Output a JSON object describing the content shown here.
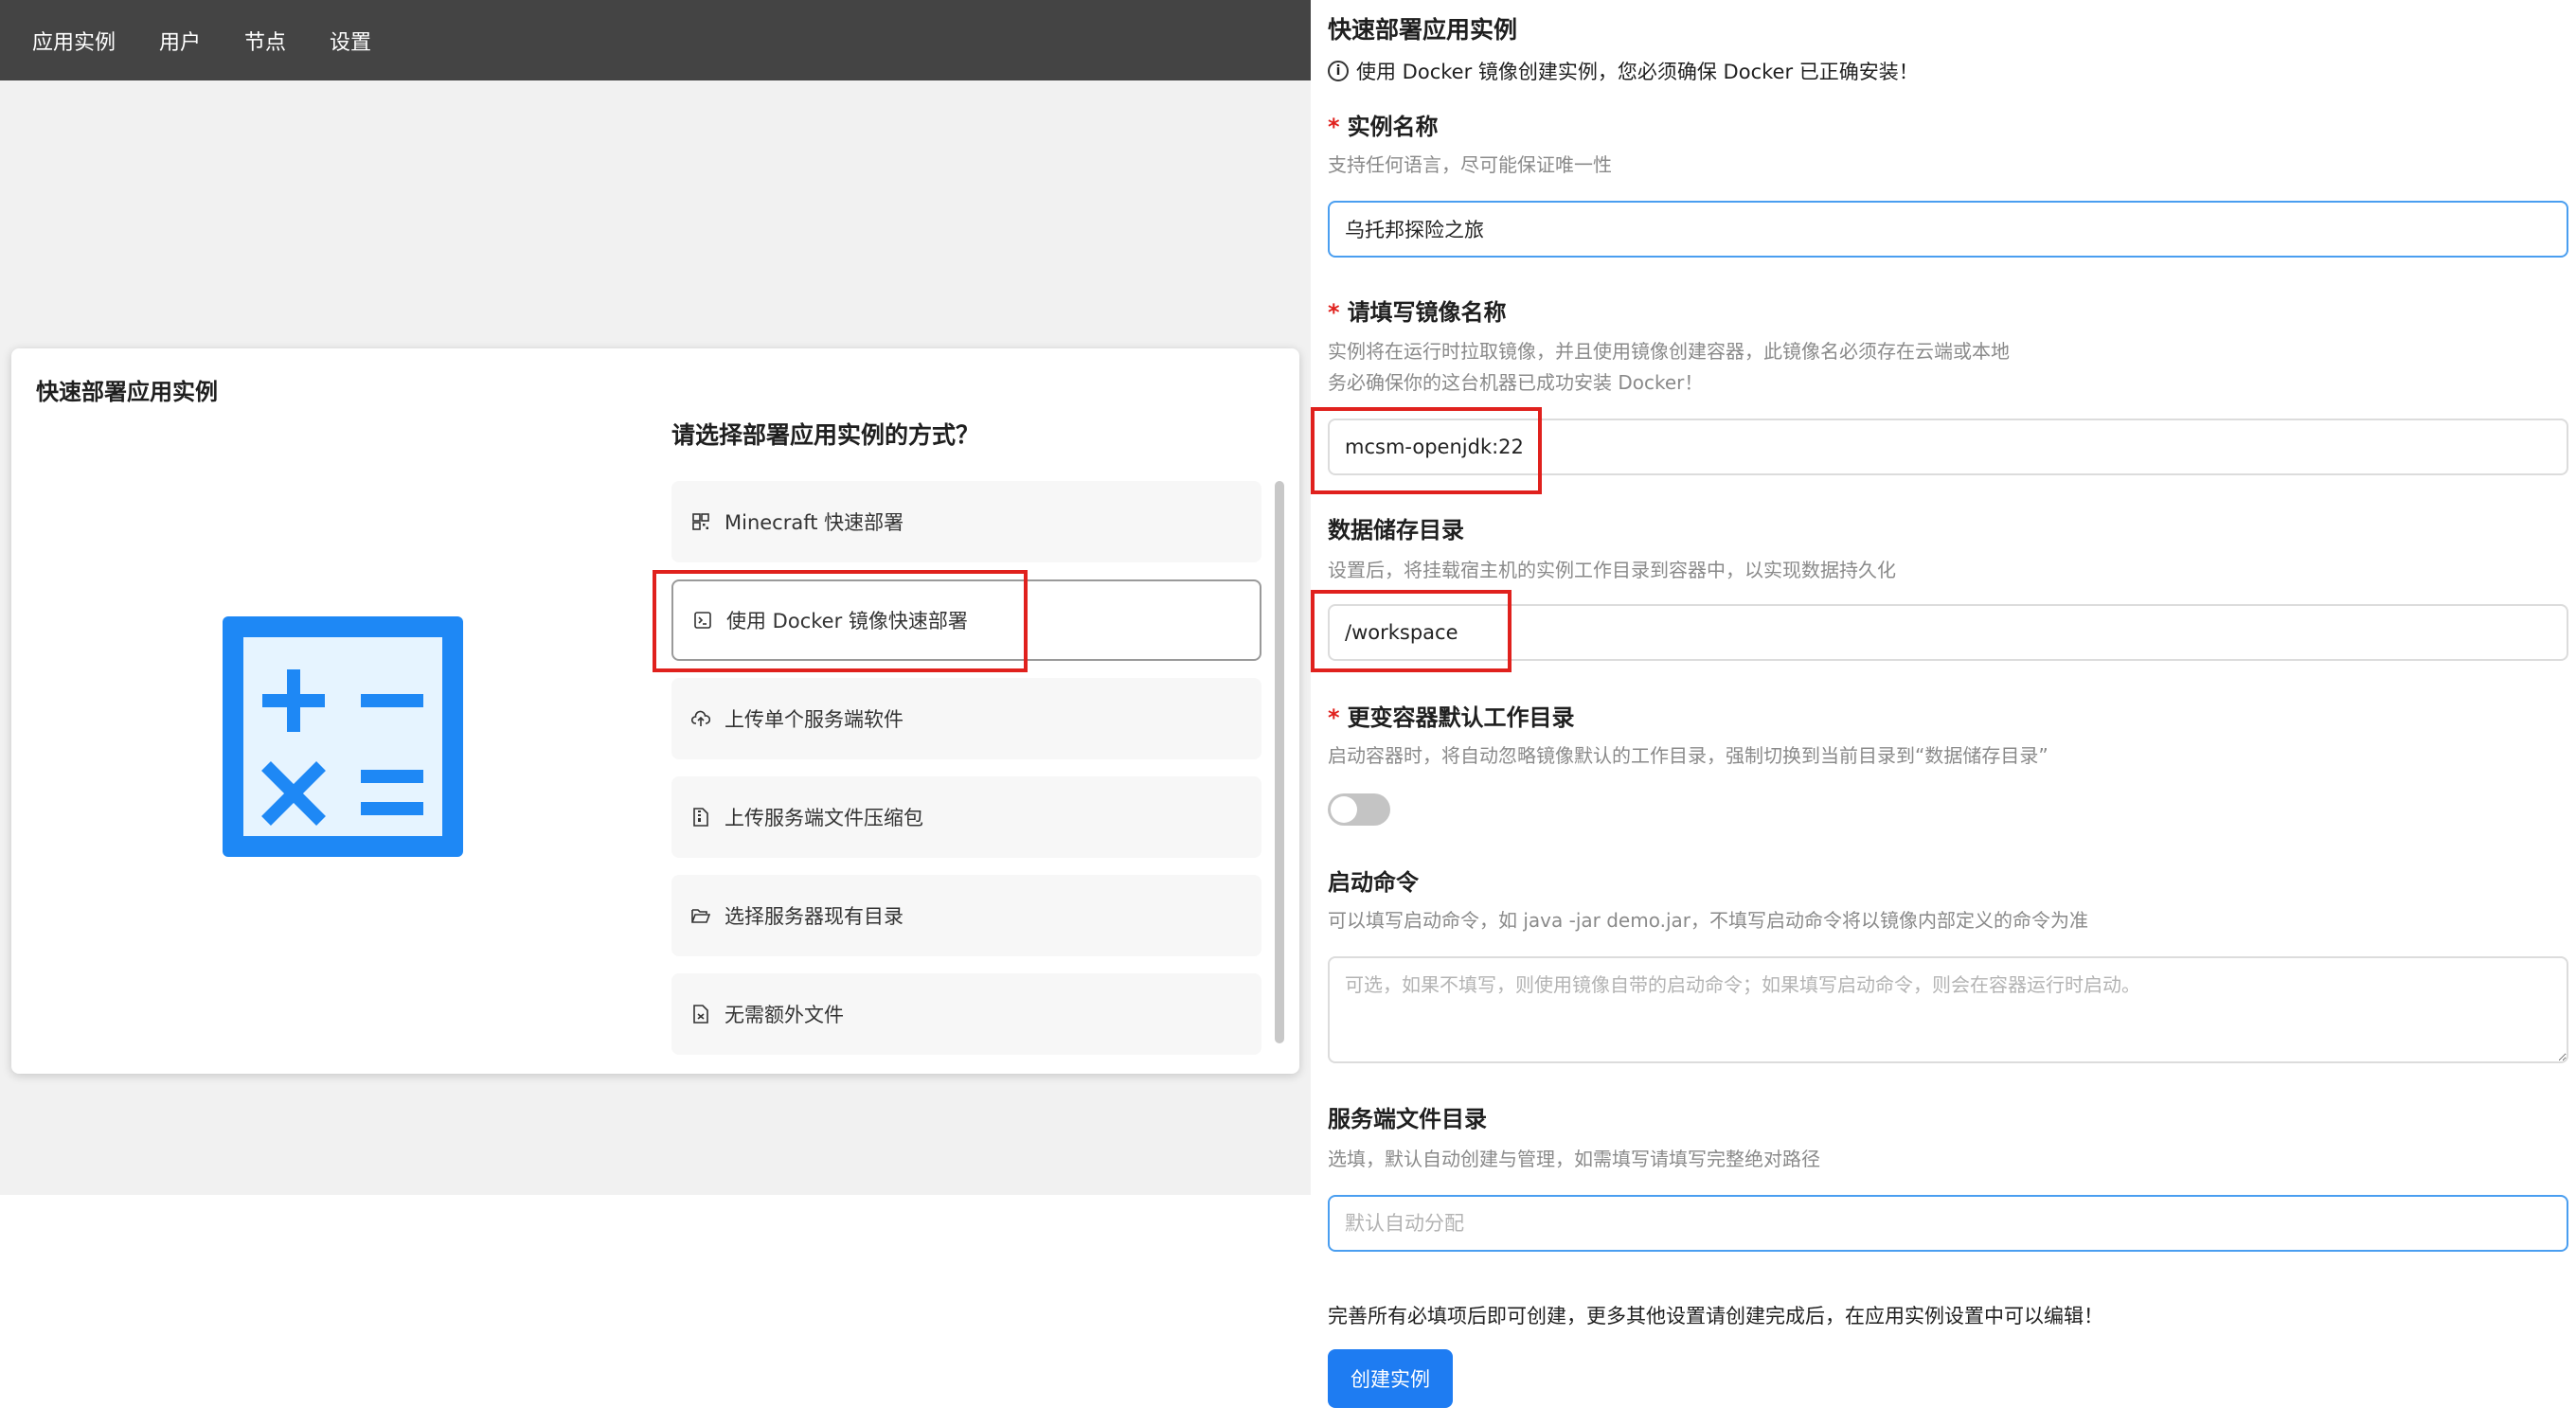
{
  "nav": {
    "items": [
      {
        "label": "应用实例"
      },
      {
        "label": "用户"
      },
      {
        "label": "节点"
      },
      {
        "label": "设置"
      }
    ]
  },
  "modal": {
    "title": "快速部署应用实例",
    "icon": "calculator-icon",
    "question": "请选择部署应用实例的方式？",
    "options": [
      {
        "label": "Minecraft 快速部署",
        "icon": "grid-app-icon",
        "selected": false
      },
      {
        "label": "使用 Docker 镜像快速部署",
        "icon": "terminal-icon",
        "selected": true
      },
      {
        "label": "上传单个服务端软件",
        "icon": "cloud-upload-icon",
        "selected": false
      },
      {
        "label": "上传服务端文件压缩包",
        "icon": "file-zip-icon",
        "selected": false
      },
      {
        "label": "选择服务器现有目录",
        "icon": "folder-open-icon",
        "selected": false
      },
      {
        "label": "无需额外文件",
        "icon": "file-empty-icon",
        "selected": false
      }
    ]
  },
  "form": {
    "title": "快速部署应用实例",
    "notice": "使用 Docker 镜像创建实例，您必须确保 Docker 已正确安装！",
    "instance_name": {
      "label": "实例名称",
      "help": "支持任何语言，尽可能保证唯一性",
      "value": "乌托邦探险之旅"
    },
    "image_name": {
      "label": "请填写镜像名称",
      "help_line1": "实例将在运行时拉取镜像，并且使用镜像创建容器，此镜像名必须存在云端或本地",
      "help_line2": "务必确保你的这台机器已成功安装 Docker！",
      "value": "mcsm-openjdk:22"
    },
    "data_dir": {
      "label": "数据储存目录",
      "help": "设置后，将挂载宿主机的实例工作目录到容器中，以实现数据持久化",
      "value": "/workspace"
    },
    "change_workdir": {
      "label": "更变容器默认工作目录",
      "help": "启动容器时，将自动忽略镜像默认的工作目录，强制切换到当前目录到“数据储存目录”",
      "enabled": false
    },
    "start_command": {
      "label": "启动命令",
      "help": "可以填写启动命令，如 java -jar demo.jar，不填写启动命令将以镜像内部定义的命令为准",
      "placeholder": "可选，如果不填写，则使用镜像自带的启动命令；如果填写启动命令，则会在容器运行时启动。"
    },
    "server_dir": {
      "label": "服务端文件目录",
      "help": "选填，默认自动创建与管理，如需填写请填写完整绝对路径",
      "placeholder": "默认自动分配"
    },
    "footer_note": "完善所有必填项后即可创建，更多其他设置请创建完成后，在应用实例设置中可以编辑！",
    "create_label": "创建实例"
  },
  "colors": {
    "nav_bg": "#444444",
    "accent": "#1e7cf2",
    "icon_blue": "#1e88f5",
    "highlight_red": "#e0211d",
    "required": "#e0211d"
  }
}
